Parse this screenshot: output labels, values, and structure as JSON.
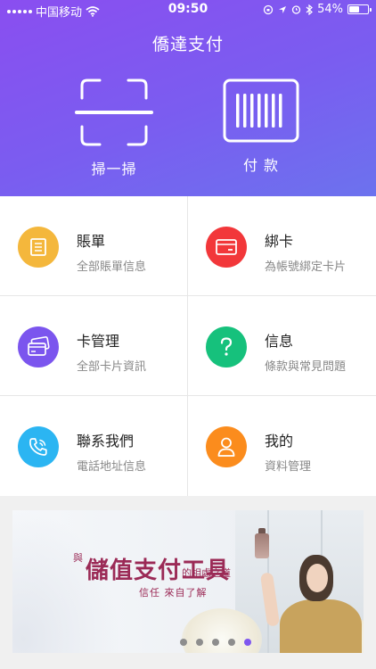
{
  "status_bar": {
    "carrier": "中国移动",
    "time": "09:50",
    "battery_percent": "54%",
    "battery_level": 0.54
  },
  "header": {
    "title": "僑達支付",
    "scan_label": "掃一掃",
    "pay_label": "付 款"
  },
  "menu": [
    {
      "title": "賬單",
      "subtitle": "全部賬單信息",
      "icon": "bill-icon",
      "color": "#f4b73c"
    },
    {
      "title": "綁卡",
      "subtitle": "為帳號綁定卡片",
      "icon": "card-icon",
      "color": "#f2373a"
    },
    {
      "title": "卡管理",
      "subtitle": "全部卡片資訊",
      "icon": "cards-icon",
      "color": "#7b55ee"
    },
    {
      "title": "信息",
      "subtitle": "條款與常見問題",
      "icon": "question-icon",
      "color": "#16c17c"
    },
    {
      "title": "聯系我們",
      "subtitle": "電話地址信息",
      "icon": "phone-icon",
      "color": "#2bb5f2"
    },
    {
      "title": "我的",
      "subtitle": "資料管理",
      "icon": "user-icon",
      "color": "#fb8c1d"
    }
  ],
  "banner": {
    "pre": "與",
    "main": "儲值支付工具",
    "post": "的相處之道",
    "sub": "信任 來自了解",
    "dots": 5,
    "active_dot": 4
  }
}
